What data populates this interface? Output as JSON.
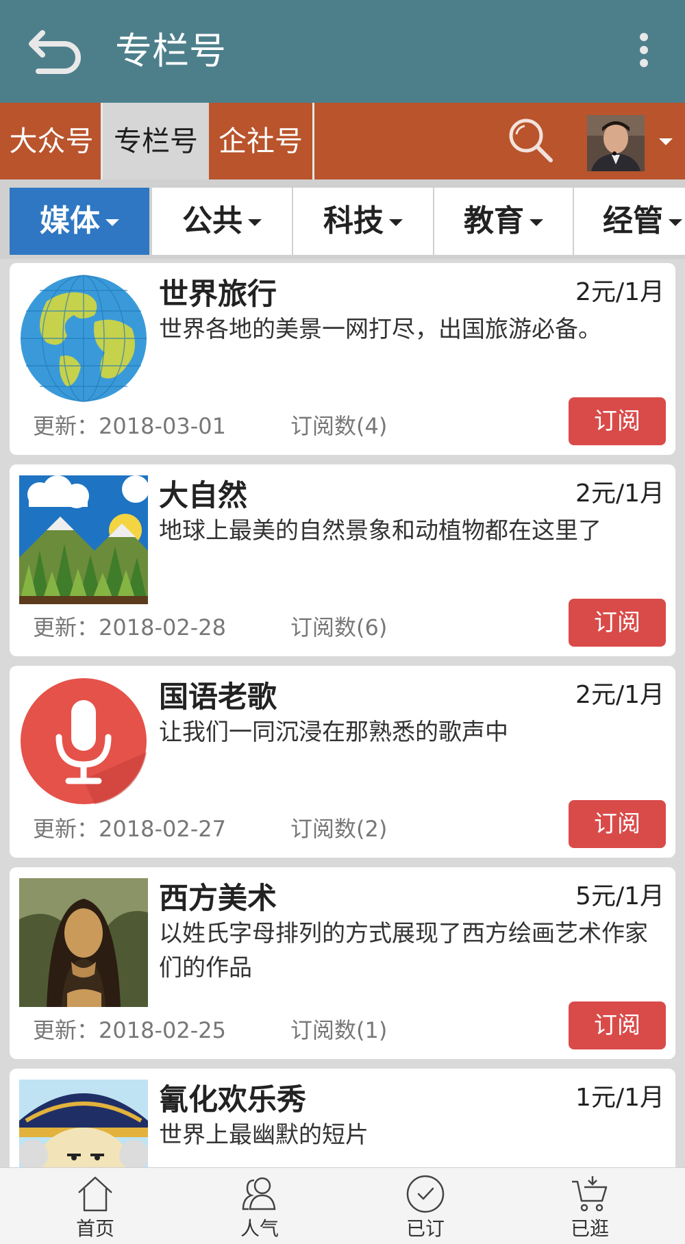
{
  "header": {
    "title": "专栏号"
  },
  "channels": [
    {
      "label": "大众号"
    },
    {
      "label": "专栏号"
    },
    {
      "label": "企社号"
    }
  ],
  "categories": [
    {
      "label": "媒体"
    },
    {
      "label": "公共"
    },
    {
      "label": "科技"
    },
    {
      "label": "教育"
    },
    {
      "label": "经管"
    }
  ],
  "cards": [
    {
      "title": "世界旅行",
      "price": "2元/1月",
      "desc": "世界各地的美景一网打尽，出国旅游必备。",
      "update": "更新：2018-03-01",
      "subs": "订阅数(4)",
      "button": "订阅",
      "thumb": "globe-image"
    },
    {
      "title": "大自然",
      "price": "2元/1月",
      "desc": "地球上最美的自然景象和动植物都在这里了",
      "update": "更新：2018-02-28",
      "subs": "订阅数(6)",
      "button": "订阅",
      "thumb": "forest-image"
    },
    {
      "title": "国语老歌",
      "price": "2元/1月",
      "desc": "让我们一同沉浸在那熟悉的歌声中",
      "update": "更新：2018-02-27",
      "subs": "订阅数(2)",
      "button": "订阅",
      "thumb": "microphone-image"
    },
    {
      "title": "西方美术",
      "price": "5元/1月",
      "desc": "以姓氏字母排列的方式展现了西方绘画艺术作家们的作品",
      "update": "更新：2018-02-25",
      "subs": "订阅数(1)",
      "button": "订阅",
      "thumb": "painting-image"
    },
    {
      "title": "氰化欢乐秀",
      "price": "1元/1月",
      "desc": "世界上最幽默的短片",
      "thumb": "cartoon-image"
    }
  ],
  "bottom_nav": [
    {
      "label": "首页",
      "icon": "home-icon"
    },
    {
      "label": "人气",
      "icon": "people-icon"
    },
    {
      "label": "已订",
      "icon": "check-circle-icon"
    },
    {
      "label": "已逛",
      "icon": "cart-icon"
    }
  ],
  "colors": {
    "topbar": "#4d7f8b",
    "channel_bar": "#b9542c",
    "active_category": "#2f77c2",
    "subscribe_button": "#d94b49"
  }
}
